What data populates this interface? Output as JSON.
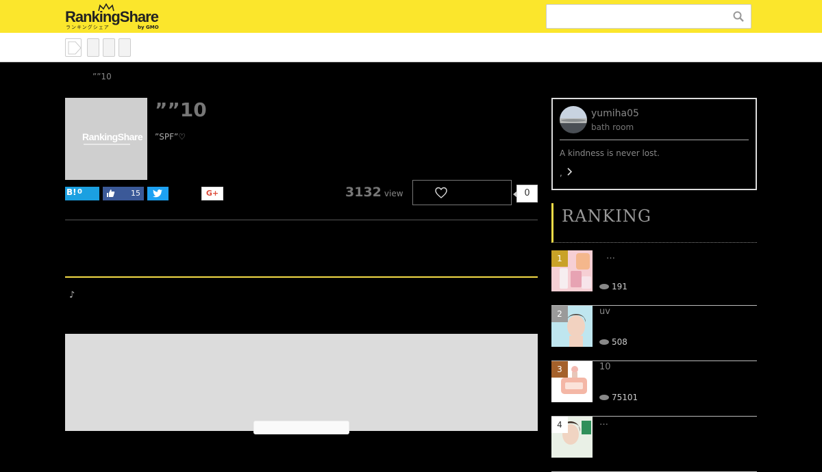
{
  "header": {
    "logo_text": "RankingShare",
    "logo_sub": "ランキングシェア",
    "logo_gmo": "by GMO",
    "search_placeholder": ""
  },
  "breadcrumb": "””10",
  "article": {
    "title": "””10",
    "description": "”SPF”♡",
    "thumbnail_text": "RankingShare",
    "share": {
      "hatena_label": "B!",
      "hatena_count": "0",
      "like_count": "15",
      "gplus_label": "G+"
    },
    "views": "3132",
    "views_unit": "view",
    "favorite_count": "0",
    "note": "♪"
  },
  "profile": {
    "name": "yumiha05",
    "room": "bath room",
    "bio": "A kindness is never lost.",
    "more": ","
  },
  "ranking": {
    "title": "RANKING",
    "items": [
      {
        "rank": "1",
        "name": "…",
        "count": "191",
        "rank_color": "#c9a227"
      },
      {
        "rank": "2",
        "name": "uv",
        "count": "508",
        "rank_color": "#9a9a9a"
      },
      {
        "rank": "3",
        "name": "10",
        "count": "75101",
        "rank_color": "#a4612b"
      },
      {
        "rank": "4",
        "name": "…",
        "count": "",
        "rank_color": "#ffffff"
      }
    ]
  }
}
